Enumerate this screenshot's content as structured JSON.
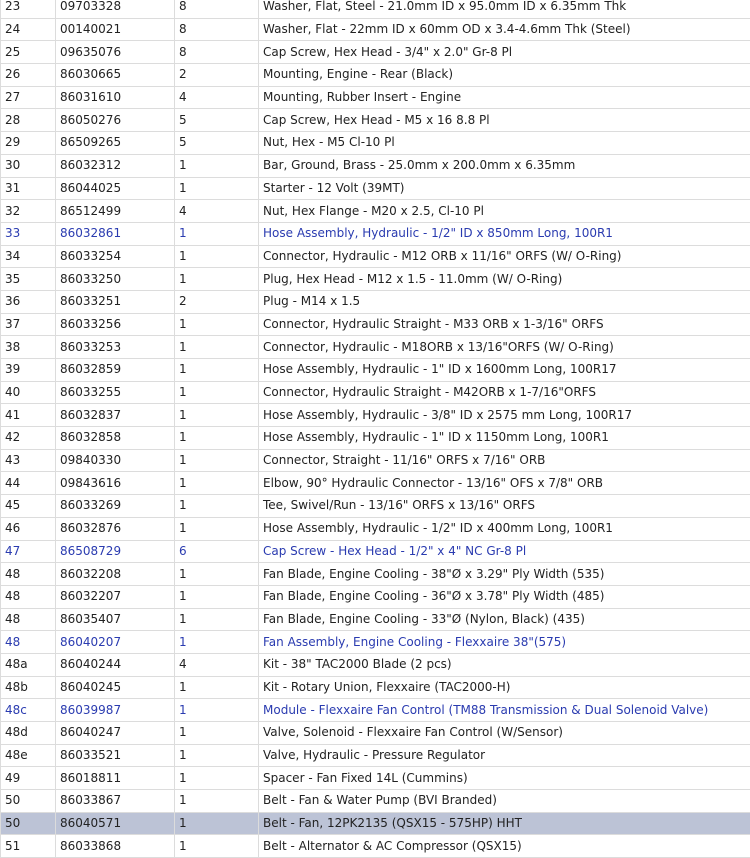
{
  "parts": {
    "rows": [
      {
        "num": "23",
        "part": "09703328",
        "qty": "8",
        "desc": "Washer, Flat, Steel - 21.0mm ID x 95.0mm ID x 6.35mm Thk"
      },
      {
        "num": "24",
        "part": "00140021",
        "qty": "8",
        "desc": "Washer, Flat - 22mm ID x 60mm OD x 3.4-4.6mm Thk (Steel)"
      },
      {
        "num": "25",
        "part": "09635076",
        "qty": "8",
        "desc": "Cap Screw, Hex Head - 3/4\" x 2.0\" Gr-8 Pl"
      },
      {
        "num": "26",
        "part": "86030665",
        "qty": "2",
        "desc": "Mounting, Engine - Rear (Black)"
      },
      {
        "num": "27",
        "part": "86031610",
        "qty": "4",
        "desc": "Mounting, Rubber Insert - Engine"
      },
      {
        "num": "28",
        "part": "86050276",
        "qty": "5",
        "desc": "Cap Screw, Hex Head - M5 x 16 8.8 Pl"
      },
      {
        "num": "29",
        "part": "86509265",
        "qty": "5",
        "desc": "Nut, Hex - M5 Cl-10 Pl"
      },
      {
        "num": "30",
        "part": "86032312",
        "qty": "1",
        "desc": "Bar, Ground, Brass - 25.0mm x 200.0mm x 6.35mm"
      },
      {
        "num": "31",
        "part": "86044025",
        "qty": "1",
        "desc": "Starter - 12 Volt (39MT)"
      },
      {
        "num": "32",
        "part": "86512499",
        "qty": "4",
        "desc": "Nut, Hex Flange - M20 x 2.5, Cl-10 Pl"
      },
      {
        "num": "33",
        "part": "86032861",
        "qty": "1",
        "desc": "Hose Assembly, Hydraulic - 1/2\" ID x 850mm Long, 100R1",
        "link": true
      },
      {
        "num": "34",
        "part": "86033254",
        "qty": "1",
        "desc": "Connector, Hydraulic - M12 ORB x 11/16\" ORFS (W/ O-Ring)"
      },
      {
        "num": "35",
        "part": "86033250",
        "qty": "1",
        "desc": "Plug, Hex Head - M12 x 1.5 - 11.0mm (W/ O-Ring)"
      },
      {
        "num": "36",
        "part": "86033251",
        "qty": "2",
        "desc": "Plug - M14 x 1.5"
      },
      {
        "num": "37",
        "part": "86033256",
        "qty": "1",
        "desc": "Connector, Hydraulic Straight - M33 ORB x 1-3/16\" ORFS"
      },
      {
        "num": "38",
        "part": "86033253",
        "qty": "1",
        "desc": "Connector, Hydraulic - M18ORB x 13/16\"ORFS (W/ O-Ring)"
      },
      {
        "num": "39",
        "part": "86032859",
        "qty": "1",
        "desc": "Hose Assembly, Hydraulic - 1\" ID x 1600mm Long, 100R17"
      },
      {
        "num": "40",
        "part": "86033255",
        "qty": "1",
        "desc": "Connector, Hydraulic Straight - M42ORB x 1-7/16\"ORFS"
      },
      {
        "num": "41",
        "part": "86032837",
        "qty": "1",
        "desc": "Hose Assembly, Hydraulic - 3/8\" ID x 2575 mm Long, 100R17"
      },
      {
        "num": "42",
        "part": "86032858",
        "qty": "1",
        "desc": "Hose Assembly, Hydraulic - 1\" ID x 1150mm Long, 100R1"
      },
      {
        "num": "43",
        "part": "09840330",
        "qty": "1",
        "desc": "Connector, Straight - 11/16\" ORFS x 7/16\" ORB"
      },
      {
        "num": "44",
        "part": "09843616",
        "qty": "1",
        "desc": "Elbow, 90° Hydraulic Connector - 13/16\" OFS x 7/8\" ORB"
      },
      {
        "num": "45",
        "part": "86033269",
        "qty": "1",
        "desc": "Tee, Swivel/Run - 13/16\" ORFS x 13/16\" ORFS"
      },
      {
        "num": "46",
        "part": "86032876",
        "qty": "1",
        "desc": "Hose Assembly, Hydraulic - 1/2\" ID x 400mm Long, 100R1"
      },
      {
        "num": "47",
        "part": "86508729",
        "qty": "6",
        "desc": "Cap Screw - Hex Head - 1/2\" x 4\" NC Gr-8 Pl",
        "link": true
      },
      {
        "num": "48",
        "part": "86032208",
        "qty": "1",
        "desc": "Fan Blade, Engine Cooling - 38\"Ø x 3.29\" Ply Width (535)"
      },
      {
        "num": "48",
        "part": "86032207",
        "qty": "1",
        "desc": "Fan Blade, Engine Cooling - 36\"Ø x 3.78\" Ply Width (485)"
      },
      {
        "num": "48",
        "part": "86035407",
        "qty": "1",
        "desc": "Fan Blade, Engine Cooling - 33\"Ø (Nylon, Black) (435)"
      },
      {
        "num": "48",
        "part": "86040207",
        "qty": "1",
        "desc": "Fan Assembly, Engine Cooling - Flexxaire 38\"(575)",
        "link": true
      },
      {
        "num": "48a",
        "part": "86040244",
        "qty": "4",
        "desc": "Kit - 38\" TAC2000 Blade (2 pcs)"
      },
      {
        "num": "48b",
        "part": "86040245",
        "qty": "1",
        "desc": "Kit - Rotary Union, Flexxaire (TAC2000-H)"
      },
      {
        "num": "48c",
        "part": "86039987",
        "qty": "1",
        "desc": "Module - Flexxaire Fan Control (TM88 Transmission & Dual Solenoid Valve)",
        "link": true
      },
      {
        "num": "48d",
        "part": "86040247",
        "qty": "1",
        "desc": "Valve, Solenoid - Flexxaire Fan Control (W/Sensor)"
      },
      {
        "num": "48e",
        "part": "86033521",
        "qty": "1",
        "desc": "Valve, Hydraulic - Pressure Regulator"
      },
      {
        "num": "49",
        "part": "86018811",
        "qty": "1",
        "desc": "Spacer - Fan Fixed 14L (Cummins)"
      },
      {
        "num": "50",
        "part": "86033867",
        "qty": "1",
        "desc": "Belt - Fan & Water Pump (BVI Branded)"
      },
      {
        "num": "50",
        "part": "86040571",
        "qty": "1",
        "desc": "Belt - Fan, 12PK2135 (QSX15 - 575HP) HHT",
        "selected": true
      },
      {
        "num": "51",
        "part": "86033868",
        "qty": "1",
        "desc": "Belt - Alternator & AC Compressor (QSX15)"
      }
    ]
  },
  "colors": {
    "link": "#2a3bb0",
    "selected_row": "#bcc3d6",
    "grid": "#dcdcdc"
  }
}
